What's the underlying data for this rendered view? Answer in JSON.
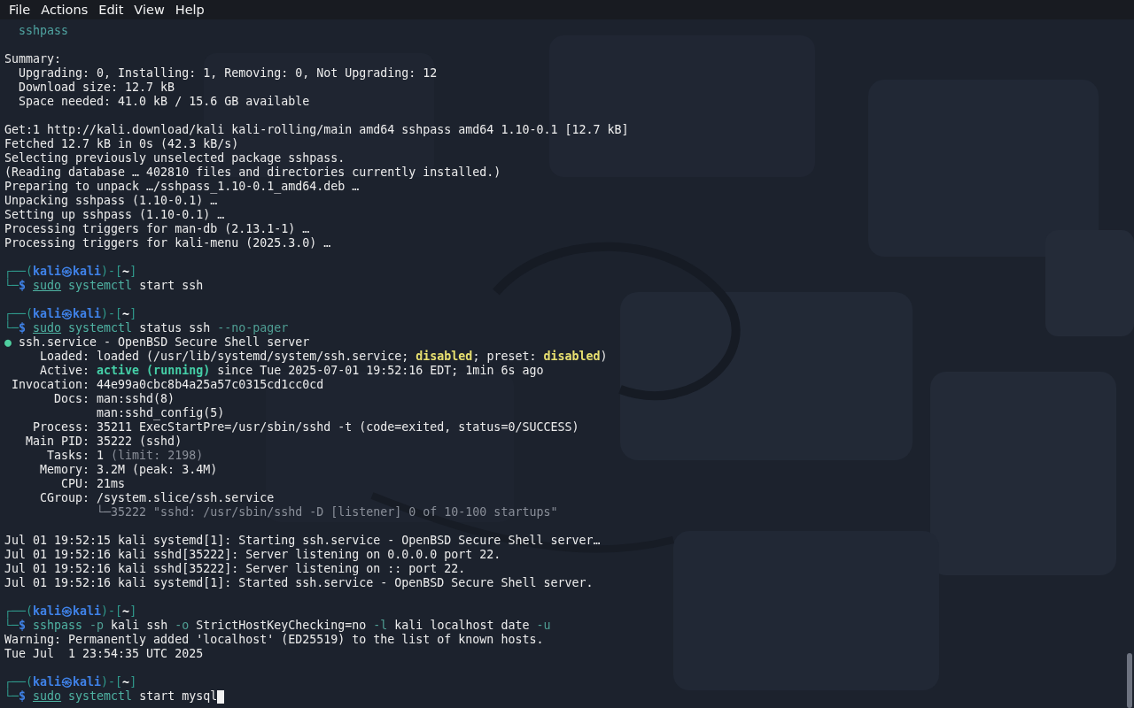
{
  "menu_bar": {
    "items": [
      "File",
      "Actions",
      "Edit",
      "View",
      "Help"
    ]
  },
  "terminal": {
    "lines": [
      {
        "kind": "text",
        "segments": [
          {
            "kind": "package",
            "text": "  sshpass"
          }
        ]
      },
      {
        "kind": "blank"
      },
      {
        "kind": "text",
        "segments": [
          {
            "kind": "plain",
            "text": "Summary:"
          }
        ]
      },
      {
        "kind": "text",
        "segments": [
          {
            "kind": "plain",
            "text": "  Upgrading: 0, Installing: 1, Removing: 0, Not Upgrading: 12"
          }
        ]
      },
      {
        "kind": "text",
        "segments": [
          {
            "kind": "plain",
            "text": "  Download size: 12.7 kB"
          }
        ]
      },
      {
        "kind": "text",
        "segments": [
          {
            "kind": "plain",
            "text": "  Space needed: 41.0 kB / 15.6 GB available"
          }
        ]
      },
      {
        "kind": "blank"
      },
      {
        "kind": "text",
        "segments": [
          {
            "kind": "plain",
            "text": "Get:1 http://kali.download/kali kali-rolling/main amd64 sshpass amd64 1.10-0.1 [12.7 kB]"
          }
        ]
      },
      {
        "kind": "text",
        "segments": [
          {
            "kind": "plain",
            "text": "Fetched 12.7 kB in 0s (42.3 kB/s)"
          }
        ]
      },
      {
        "kind": "text",
        "segments": [
          {
            "kind": "plain",
            "text": "Selecting previously unselected package sshpass."
          }
        ]
      },
      {
        "kind": "text",
        "segments": [
          {
            "kind": "plain",
            "text": "(Reading database … 402810 files and directories currently installed.)"
          }
        ]
      },
      {
        "kind": "text",
        "segments": [
          {
            "kind": "plain",
            "text": "Preparing to unpack …/sshpass_1.10-0.1_amd64.deb …"
          }
        ]
      },
      {
        "kind": "text",
        "segments": [
          {
            "kind": "plain",
            "text": "Unpacking sshpass (1.10-0.1) …"
          }
        ]
      },
      {
        "kind": "text",
        "segments": [
          {
            "kind": "plain",
            "text": "Setting up sshpass (1.10-0.1) …"
          }
        ]
      },
      {
        "kind": "text",
        "segments": [
          {
            "kind": "plain",
            "text": "Processing triggers for man-db (2.13.1-1) …"
          }
        ]
      },
      {
        "kind": "text",
        "segments": [
          {
            "kind": "plain",
            "text": "Processing triggers for kali-menu (2025.3.0) …"
          }
        ]
      },
      {
        "kind": "blank"
      },
      {
        "kind": "prompt",
        "segments": [
          {
            "kind": "frame",
            "text": "┌──("
          },
          {
            "kind": "user",
            "text": "kali㉿kali"
          },
          {
            "kind": "frame",
            "text": ")-["
          },
          {
            "kind": "dir",
            "text": "~"
          },
          {
            "kind": "frame",
            "text": "]"
          }
        ]
      },
      {
        "kind": "command",
        "segments": [
          {
            "kind": "frame",
            "text": "└─"
          },
          {
            "kind": "sigil",
            "text": "$ "
          },
          {
            "kind": "sudo",
            "text": "sudo"
          },
          {
            "kind": "command",
            "text": " systemctl"
          },
          {
            "kind": "plain",
            "text": " start ssh"
          }
        ]
      },
      {
        "kind": "blank"
      },
      {
        "kind": "prompt",
        "segments": [
          {
            "kind": "frame",
            "text": "┌──("
          },
          {
            "kind": "user",
            "text": "kali㉿kali"
          },
          {
            "kind": "frame",
            "text": ")-["
          },
          {
            "kind": "dir",
            "text": "~"
          },
          {
            "kind": "frame",
            "text": "]"
          }
        ]
      },
      {
        "kind": "command",
        "segments": [
          {
            "kind": "frame",
            "text": "└─"
          },
          {
            "kind": "sigil",
            "text": "$ "
          },
          {
            "kind": "sudo",
            "text": "sudo"
          },
          {
            "kind": "command",
            "text": " systemctl"
          },
          {
            "kind": "plain",
            "text": " status ssh "
          },
          {
            "kind": "option",
            "text": "--no-pager"
          }
        ]
      },
      {
        "kind": "text",
        "segments": [
          {
            "kind": "dot",
            "text": "●"
          },
          {
            "kind": "plain",
            "text": " ssh.service - OpenBSD Secure Shell server"
          }
        ]
      },
      {
        "kind": "text",
        "segments": [
          {
            "kind": "plain",
            "text": "     Loaded: loaded (/usr/lib/systemd/system/ssh.service; "
          },
          {
            "kind": "warn",
            "text": "disabled"
          },
          {
            "kind": "plain",
            "text": "; preset: "
          },
          {
            "kind": "warn",
            "text": "disabled"
          },
          {
            "kind": "plain",
            "text": ")"
          }
        ]
      },
      {
        "kind": "text",
        "segments": [
          {
            "kind": "plain",
            "text": "     Active: "
          },
          {
            "kind": "good",
            "text": "active (running)"
          },
          {
            "kind": "plain",
            "text": " since Tue 2025-07-01 19:52:16 EDT; 1min 6s ago"
          }
        ]
      },
      {
        "kind": "text",
        "segments": [
          {
            "kind": "plain",
            "text": " Invocation: 44e99a0cbc8b4a25a57c0315cd1cc0cd"
          }
        ]
      },
      {
        "kind": "text",
        "segments": [
          {
            "kind": "plain",
            "text": "       Docs: man:sshd(8)"
          }
        ]
      },
      {
        "kind": "text",
        "segments": [
          {
            "kind": "plain",
            "text": "             man:sshd_config(5)"
          }
        ]
      },
      {
        "kind": "text",
        "segments": [
          {
            "kind": "plain",
            "text": "    Process: 35211 ExecStartPre=/usr/sbin/sshd -t (code=exited, status=0/SUCCESS)"
          }
        ]
      },
      {
        "kind": "text",
        "segments": [
          {
            "kind": "plain",
            "text": "   Main PID: 35222 (sshd)"
          }
        ]
      },
      {
        "kind": "text",
        "segments": [
          {
            "kind": "plain",
            "text": "      Tasks: 1 "
          },
          {
            "kind": "dim",
            "text": "(limit: 2198)"
          }
        ]
      },
      {
        "kind": "text",
        "segments": [
          {
            "kind": "plain",
            "text": "     Memory: 3.2M (peak: 3.4M)"
          }
        ]
      },
      {
        "kind": "text",
        "segments": [
          {
            "kind": "plain",
            "text": "        CPU: 21ms"
          }
        ]
      },
      {
        "kind": "text",
        "segments": [
          {
            "kind": "plain",
            "text": "     CGroup: /system.slice/ssh.service"
          }
        ]
      },
      {
        "kind": "text",
        "segments": [
          {
            "kind": "dim",
            "text": "             └─35222 \"sshd: /usr/sbin/sshd -D [listener] 0 of 10-100 startups\""
          }
        ]
      },
      {
        "kind": "blank"
      },
      {
        "kind": "text",
        "segments": [
          {
            "kind": "plain",
            "text": "Jul 01 19:52:15 kali systemd[1]: Starting ssh.service - OpenBSD Secure Shell server…"
          }
        ]
      },
      {
        "kind": "text",
        "segments": [
          {
            "kind": "plain",
            "text": "Jul 01 19:52:16 kali sshd[35222]: Server listening on 0.0.0.0 port 22."
          }
        ]
      },
      {
        "kind": "text",
        "segments": [
          {
            "kind": "plain",
            "text": "Jul 01 19:52:16 kali sshd[35222]: Server listening on :: port 22."
          }
        ]
      },
      {
        "kind": "text",
        "segments": [
          {
            "kind": "plain",
            "text": "Jul 01 19:52:16 kali systemd[1]: Started ssh.service - OpenBSD Secure Shell server."
          }
        ]
      },
      {
        "kind": "blank"
      },
      {
        "kind": "prompt",
        "segments": [
          {
            "kind": "frame",
            "text": "┌──("
          },
          {
            "kind": "user",
            "text": "kali㉿kali"
          },
          {
            "kind": "frame",
            "text": ")-["
          },
          {
            "kind": "dir",
            "text": "~"
          },
          {
            "kind": "frame",
            "text": "]"
          }
        ]
      },
      {
        "kind": "command",
        "segments": [
          {
            "kind": "frame",
            "text": "└─"
          },
          {
            "kind": "sigil",
            "text": "$ "
          },
          {
            "kind": "command",
            "text": "sshpass"
          },
          {
            "kind": "option",
            "text": " -p"
          },
          {
            "kind": "plain",
            "text": " kali ssh "
          },
          {
            "kind": "option",
            "text": "-o"
          },
          {
            "kind": "plain",
            "text": " StrictHostKeyChecking=no "
          },
          {
            "kind": "option",
            "text": "-l"
          },
          {
            "kind": "plain",
            "text": " kali localhost date "
          },
          {
            "kind": "option",
            "text": "-u"
          }
        ]
      },
      {
        "kind": "text",
        "segments": [
          {
            "kind": "plain",
            "text": "Warning: Permanently added 'localhost' (ED25519) to the list of known hosts."
          }
        ]
      },
      {
        "kind": "text",
        "segments": [
          {
            "kind": "plain",
            "text": "Tue Jul  1 23:54:35 UTC 2025"
          }
        ]
      },
      {
        "kind": "blank"
      },
      {
        "kind": "prompt",
        "segments": [
          {
            "kind": "frame",
            "text": "┌──("
          },
          {
            "kind": "user",
            "text": "kali㉿kali"
          },
          {
            "kind": "frame",
            "text": ")-["
          },
          {
            "kind": "dir",
            "text": "~"
          },
          {
            "kind": "frame",
            "text": "]"
          }
        ]
      },
      {
        "kind": "command",
        "cursor": true,
        "segments": [
          {
            "kind": "frame",
            "text": "└─"
          },
          {
            "kind": "sigil",
            "text": "$ "
          },
          {
            "kind": "sudo",
            "text": "sudo"
          },
          {
            "kind": "command",
            "text": " systemctl"
          },
          {
            "kind": "plain",
            "text": " start mysql"
          }
        ]
      }
    ]
  }
}
